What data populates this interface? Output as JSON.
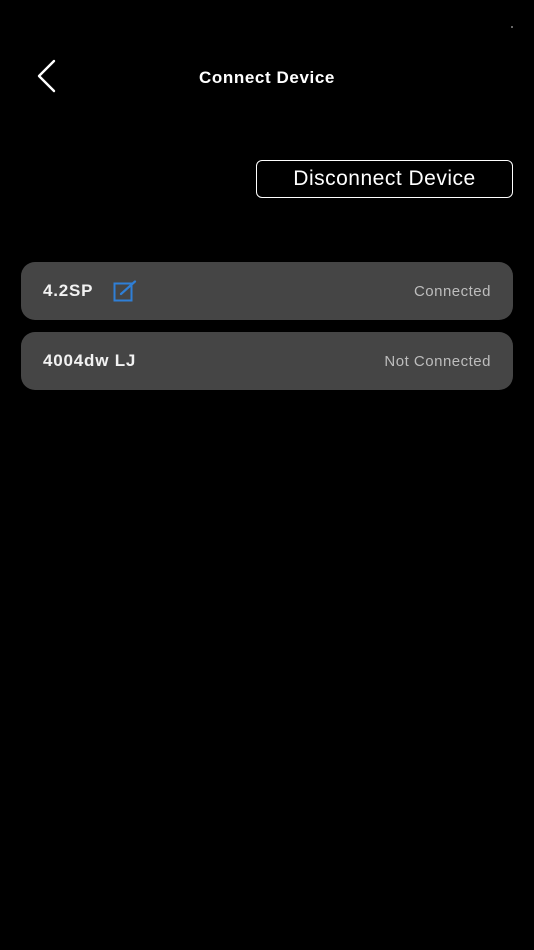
{
  "header": {
    "title": "Connect Device",
    "back_icon": "chevron-left-icon"
  },
  "actions": {
    "disconnect_label": "Disconnect Device"
  },
  "devices": [
    {
      "name": "4.2SP",
      "status": "Connected",
      "has_edit": true,
      "edit_icon": "edit-icon",
      "edit_color": "#2f7fd6"
    },
    {
      "name": "4004dw LJ",
      "status": "Not Connected",
      "has_edit": false
    }
  ],
  "colors": {
    "background": "#000000",
    "row_background": "#454545",
    "text_primary": "#ffffff",
    "text_status": "#bdbdbd",
    "accent": "#2f7fd6"
  }
}
